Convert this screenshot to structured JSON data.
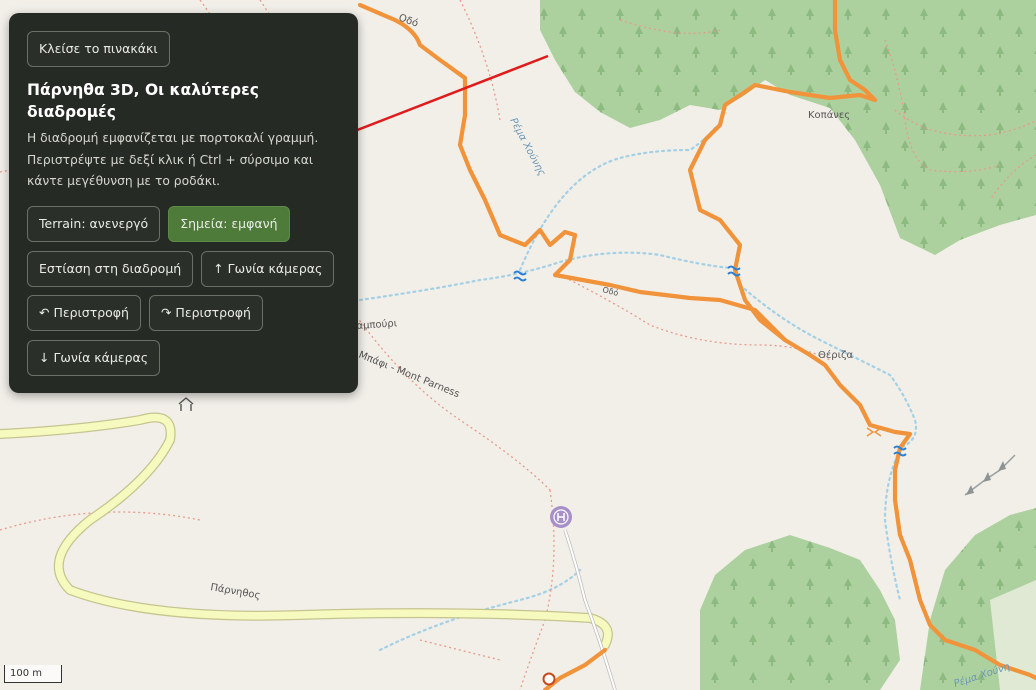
{
  "panel": {
    "close_label": "Κλείσε το πινακάκι",
    "title": "Πάρνηθα 3D, Οι καλύτερες διαδρομές",
    "description": "Η διαδρομή εμφανίζεται με πορτοκαλί γραμμή. Περιστρέψτε με δεξί κλικ ή Ctrl + σύρσιμο και κάντε μεγέθυνση με το ροδάκι.",
    "buttons": {
      "terrain": "Terrain: ανενεργό",
      "points": "Σημεία: εμφανή",
      "focus_route": "Εστίαση στη διαδρομή",
      "camera_up": "↑ Γωνία κάμερας",
      "rotate_left": "↶ Περιστροφή",
      "rotate_right": "↷ Περιστροφή",
      "camera_down": "↓ Γωνία κάμερας"
    },
    "active_color": "#4e7a3a"
  },
  "map": {
    "labels": {
      "kopanes": "Κοπάνες",
      "theriza": "Θέριζα",
      "rema_xounis": "Ρέμα Χούνης",
      "rema_xounis_2": "Ρέμα Χούνη",
      "mpafi": "Μπάφι - Mont Parness",
      "flampouri": "Φλαμπούρι",
      "parnithos": "Πάρνηθος",
      "top_road": "Οδό",
      "path_small": "Οδό"
    },
    "route_color": "#f0933a",
    "forest_color": "#add19e",
    "stream_color": "#a4d0e6",
    "road_color": "#f7fabf",
    "scale_label": "100 m",
    "icons": [
      "hut-icon",
      "spring-icon",
      "pass-icon",
      "annotation-arrow"
    ]
  }
}
